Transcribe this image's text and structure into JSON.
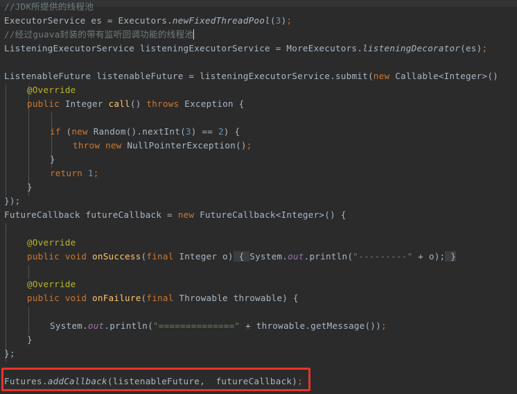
{
  "editor": {
    "theme_name": "darcula",
    "background_color": "#2b2b2b",
    "top_band_color": "#313335",
    "default_text_color": "#a9b7c6",
    "comment_color": "#707c7c",
    "keyword_color": "#cc7832",
    "number_color": "#6897bb",
    "string_color": "#6a8759",
    "annotation_color": "#bbb529",
    "static_field_color": "#9876aa",
    "method_decl_color": "#ffc66d",
    "fold_highlight_color": "#3b3e40",
    "indent_guide_color": "#585b5d",
    "annotation_box_color": "#e8332a",
    "line_height_px": "20"
  },
  "code": {
    "line_01_comment": "//JDK所提供的线程池",
    "line_02": {
      "type_a": "ExecutorService",
      "space_1": " ",
      "var_a": "es",
      "eq": " = ",
      "type_b": "Executors",
      "dot": ".",
      "method": "newFixedThreadPool",
      "paren_open": "(",
      "arg": "3",
      "paren_close": ")",
      "semi": ";"
    },
    "line_03_comment": "//经过guava封装的带有监听回调功能的线程池",
    "line_04": {
      "type_a": "ListeningExecutorService",
      "var_a": " listeningExecutorService",
      "eq": " = ",
      "type_b": "MoreExecutors",
      "dot": ".",
      "method": "listeningDecorator",
      "paren_open": "(",
      "arg": "es",
      "paren_close": ")",
      "semi": ";"
    },
    "line_05_blank": " ",
    "line_06": {
      "type_a": "ListenableFuture",
      "var_a": " listenableFuture",
      "eq": " = ",
      "receiver": "listeningExecutorService",
      "dot": ".",
      "method": "submit",
      "paren_open": "(",
      "kw_new": "new",
      "type_b": " Callable<Integer>()"
    },
    "line_07_annotation": "@Override",
    "line_08": {
      "kw_public": "public",
      "type_ret": " Integer ",
      "method": "call",
      "parens": "() ",
      "kw_throws": "throws",
      "exc": " Exception ",
      "brace": "{"
    },
    "line_09_blank": " ",
    "line_10": {
      "kw_if": "if",
      "paren_open": " (",
      "kw_new": "new",
      "type": " Random",
      "parens": "().",
      "method": "nextInt",
      "arg_open": "(",
      "arg": "3",
      "arg_close": ")",
      "op": " == ",
      "num": "2",
      "paren_close": ") ",
      "brace": "{"
    },
    "line_11": {
      "kw_throw": "throw",
      "kw_new": " new",
      "exc": " NullPointerException()",
      "semi": ";"
    },
    "line_12_close_brace": "}",
    "line_13": {
      "kw_return": "return",
      "num": " 1",
      "semi": ";"
    },
    "line_14_close_brace": "}",
    "line_15_close": "});",
    "line_16": {
      "type_a": "FutureCallback",
      "var_a": " futureCallback",
      "eq": " = ",
      "kw_new": "new",
      "type_b": " FutureCallback<Integer>() ",
      "brace": "{"
    },
    "line_17_blank": " ",
    "line_18_annotation": "@Override",
    "line_19": {
      "kw_public": "public",
      "kw_void": " void",
      "method": " onSuccess",
      "paren_open": "(",
      "kw_final": "final",
      "param": " Integer o",
      "paren_close": ")",
      "fold_open": " { ",
      "receiver": "System",
      "dot1": ".",
      "field": "out",
      "dot2": ".",
      "print": "println",
      "str_open": "(",
      "str": "\"---------\"",
      "plus": " + ",
      "arg": "o",
      "close": ");",
      "fold_close": " }"
    },
    "line_20_blank": " ",
    "line_21_annotation": "@Override",
    "line_22": {
      "kw_public": "public",
      "kw_void": " void",
      "method": " onFailure",
      "paren_open": "(",
      "kw_final": "final",
      "param": " Throwable throwable",
      "paren_close": ") ",
      "brace": "{"
    },
    "line_23_blank": " ",
    "line_24": {
      "receiver": "System",
      "dot1": ".",
      "field": "out",
      "dot2": ".",
      "print": "println",
      "paren_open": "(",
      "str": "\"==============\"",
      "plus": " + ",
      "expr": "throwable.getMessage()",
      "close": ")",
      "semi": ";"
    },
    "line_25_close_brace": "}",
    "line_26_close": "};",
    "line_27_blank": " ",
    "line_28_highlighted": {
      "receiver": "Futures",
      "dot": ".",
      "method": "addCallback",
      "paren_open": "(",
      "arg1": "listenableFuture",
      "comma": ",  ",
      "arg2": "futureCallback",
      "paren_close": ")",
      "semi": ";"
    }
  }
}
